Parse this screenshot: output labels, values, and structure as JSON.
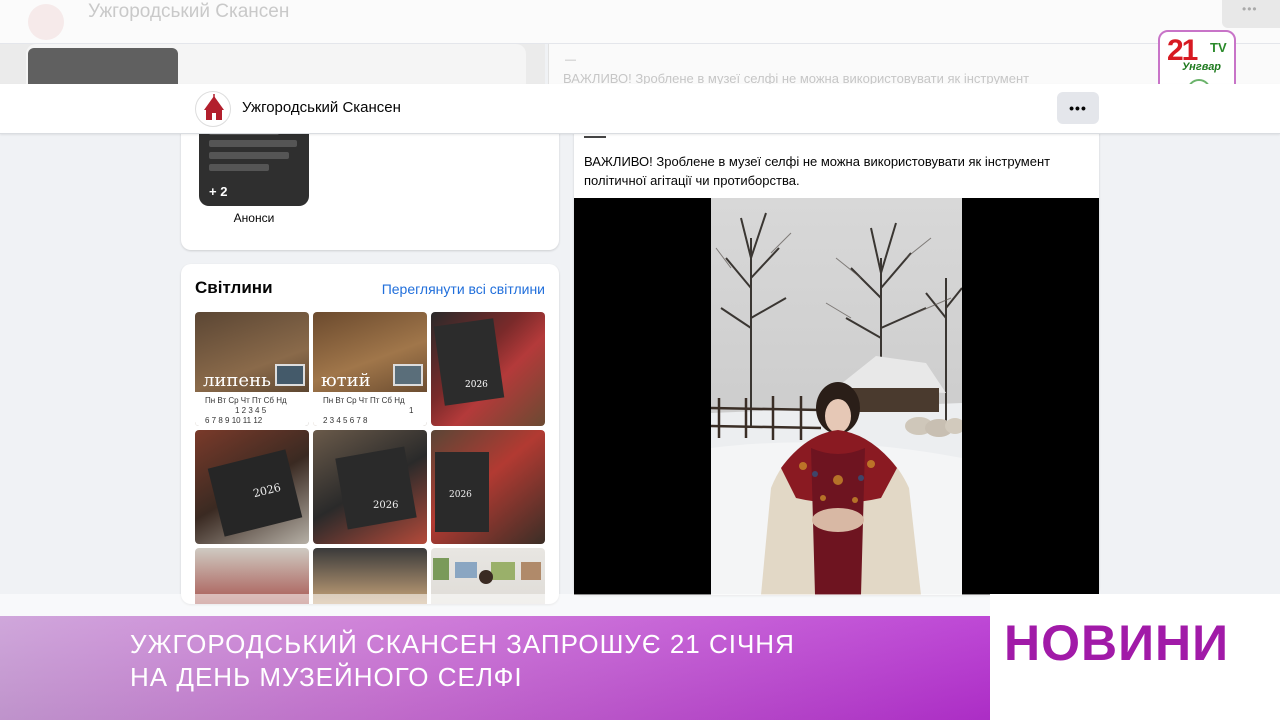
{
  "background_header": {
    "title": "Ужгородський Скансен",
    "faded_text": "ВАЖЛИВО! Зроблене в музеї селфі не можна використовувати як інструмент"
  },
  "sticky_bar": {
    "page_name": "Ужгородський Скансен",
    "more_label": "•••"
  },
  "announcements": {
    "count": "+ 2",
    "label": "Анонси"
  },
  "photos": {
    "title": "Світлини",
    "see_all": "Переглянути всі світлини",
    "calendar_1": {
      "month": "липень",
      "days_header": "Пн Вт Ср Чт Пт Сб Нд",
      "row1": "1  2  3  4  5",
      "row2": "6  7  8  9  10  11  12"
    },
    "calendar_2": {
      "month": "ютий",
      "days_header": "Пн Вт Ср Чт Пт Сб Нд",
      "row1": "1",
      "row2": "2  3  4  5  6  7  8"
    },
    "year_label": "2026"
  },
  "post": {
    "text": "ВАЖЛИВО! Зроблене в музеї селфі не можна використовувати як інструмент політичної агітації чи протиборства."
  },
  "channel_logo": {
    "number": "21",
    "tv": "TV",
    "city": "Унгвар"
  },
  "news": {
    "headline_line1": "УЖГОРОДСЬКИЙ СКАНСЕН ЗАПРОШУЄ 21 СІЧНЯ",
    "headline_line2": "НА ДЕНЬ МУЗЕЙНОГО СЕЛФІ",
    "label": "НОВИНИ"
  },
  "colors": {
    "news_purple": "#a11aa8",
    "link_blue": "#216fdb",
    "logo_red": "#d71a22",
    "logo_green": "#2a8a2a"
  }
}
